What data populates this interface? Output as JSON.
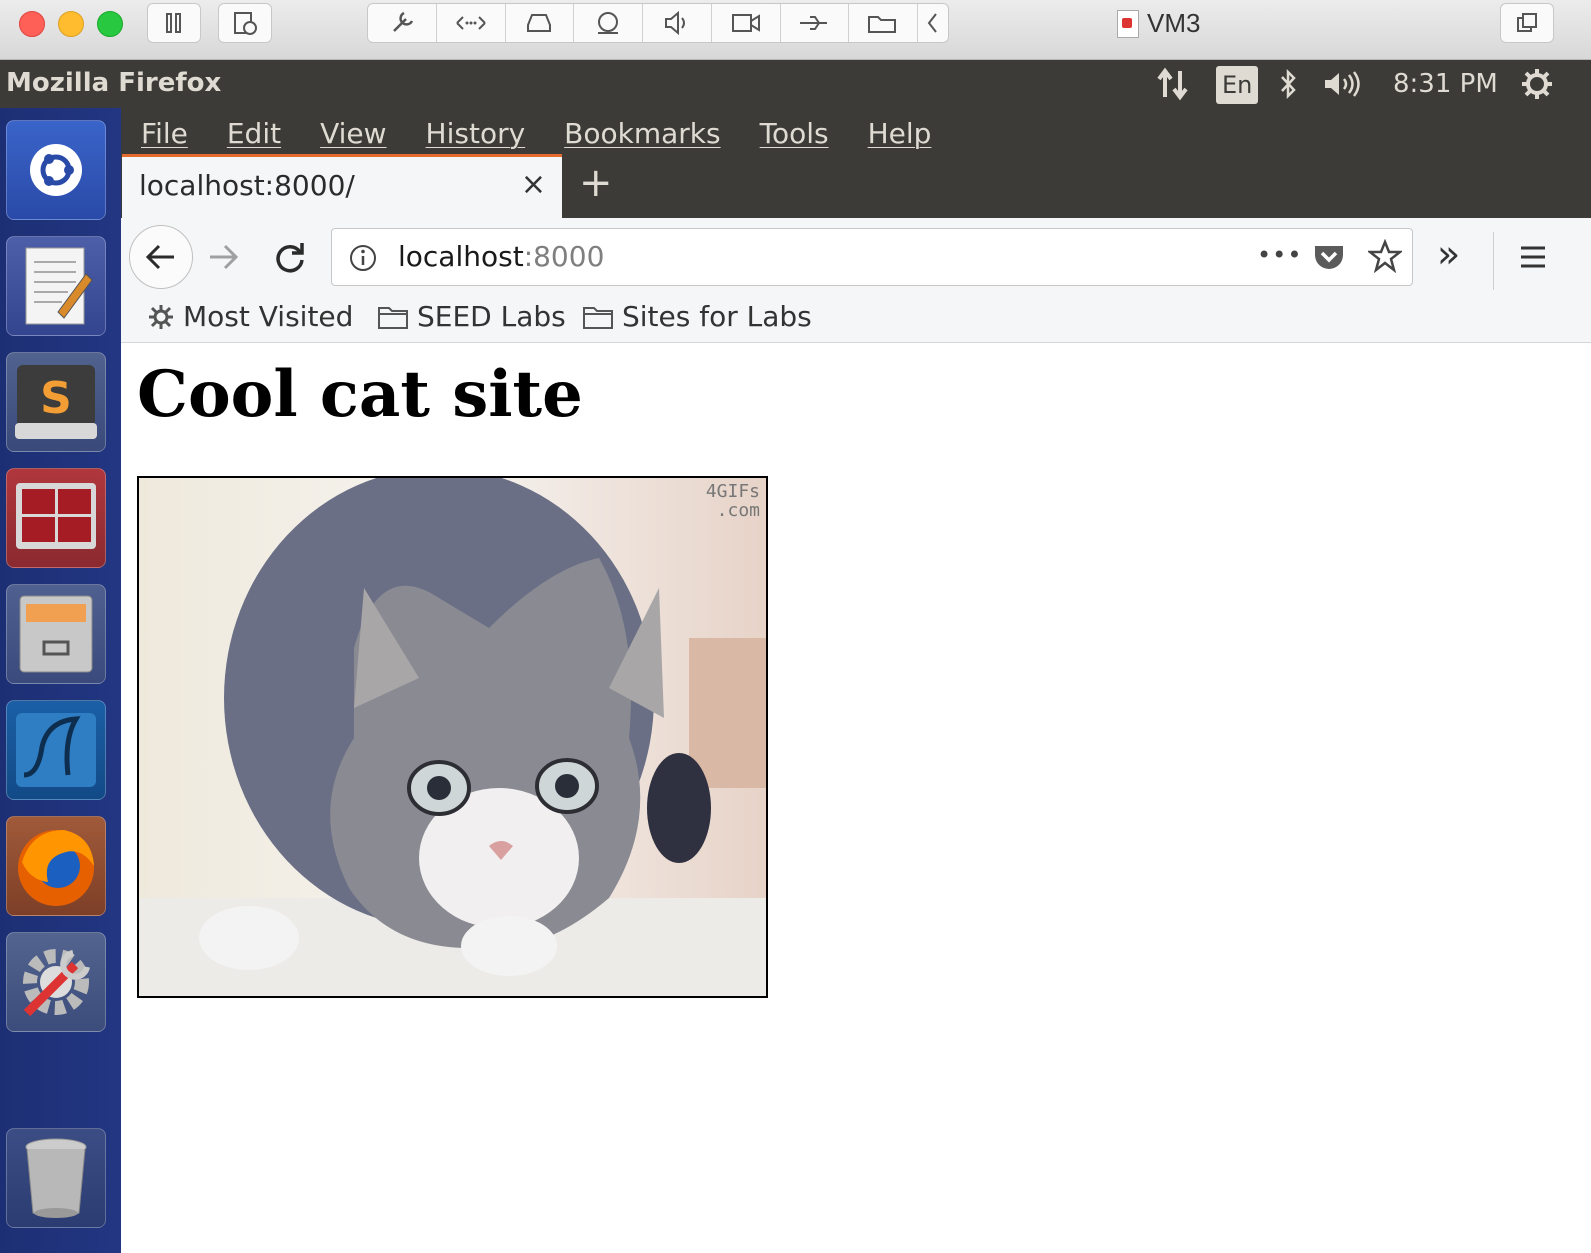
{
  "host": {
    "vm_name": "VM3"
  },
  "ubuntu_panel": {
    "app_title": "Mozilla Firefox",
    "language": "En",
    "clock": "8:31 PM"
  },
  "menubar": {
    "items": [
      "File",
      "Edit",
      "View",
      "History",
      "Bookmarks",
      "Tools",
      "Help"
    ]
  },
  "tab": {
    "title": "localhost:8000/",
    "close": "×",
    "new": "+"
  },
  "navbar": {
    "url_host": "localhost",
    "url_port": ":8000",
    "page_actions": "•••",
    "overflow": "»"
  },
  "bookmarks": {
    "items": [
      "Most Visited",
      "SEED Labs",
      "Sites for Labs"
    ]
  },
  "page": {
    "heading": "Cool cat site",
    "watermark_line1": "4GIFs",
    "watermark_line2": ".com"
  },
  "colors": {
    "panel": "#3c3b37",
    "launcher": "#1d2f74",
    "tab_accent": "#e56a2e"
  },
  "launcher_icons": [
    "ubuntu-dash-icon",
    "text-editor-icon",
    "sublime-text-icon",
    "terminal-icon",
    "file-cabinet-icon",
    "wireshark-icon",
    "firefox-icon",
    "system-settings-icon",
    "trash-icon"
  ]
}
